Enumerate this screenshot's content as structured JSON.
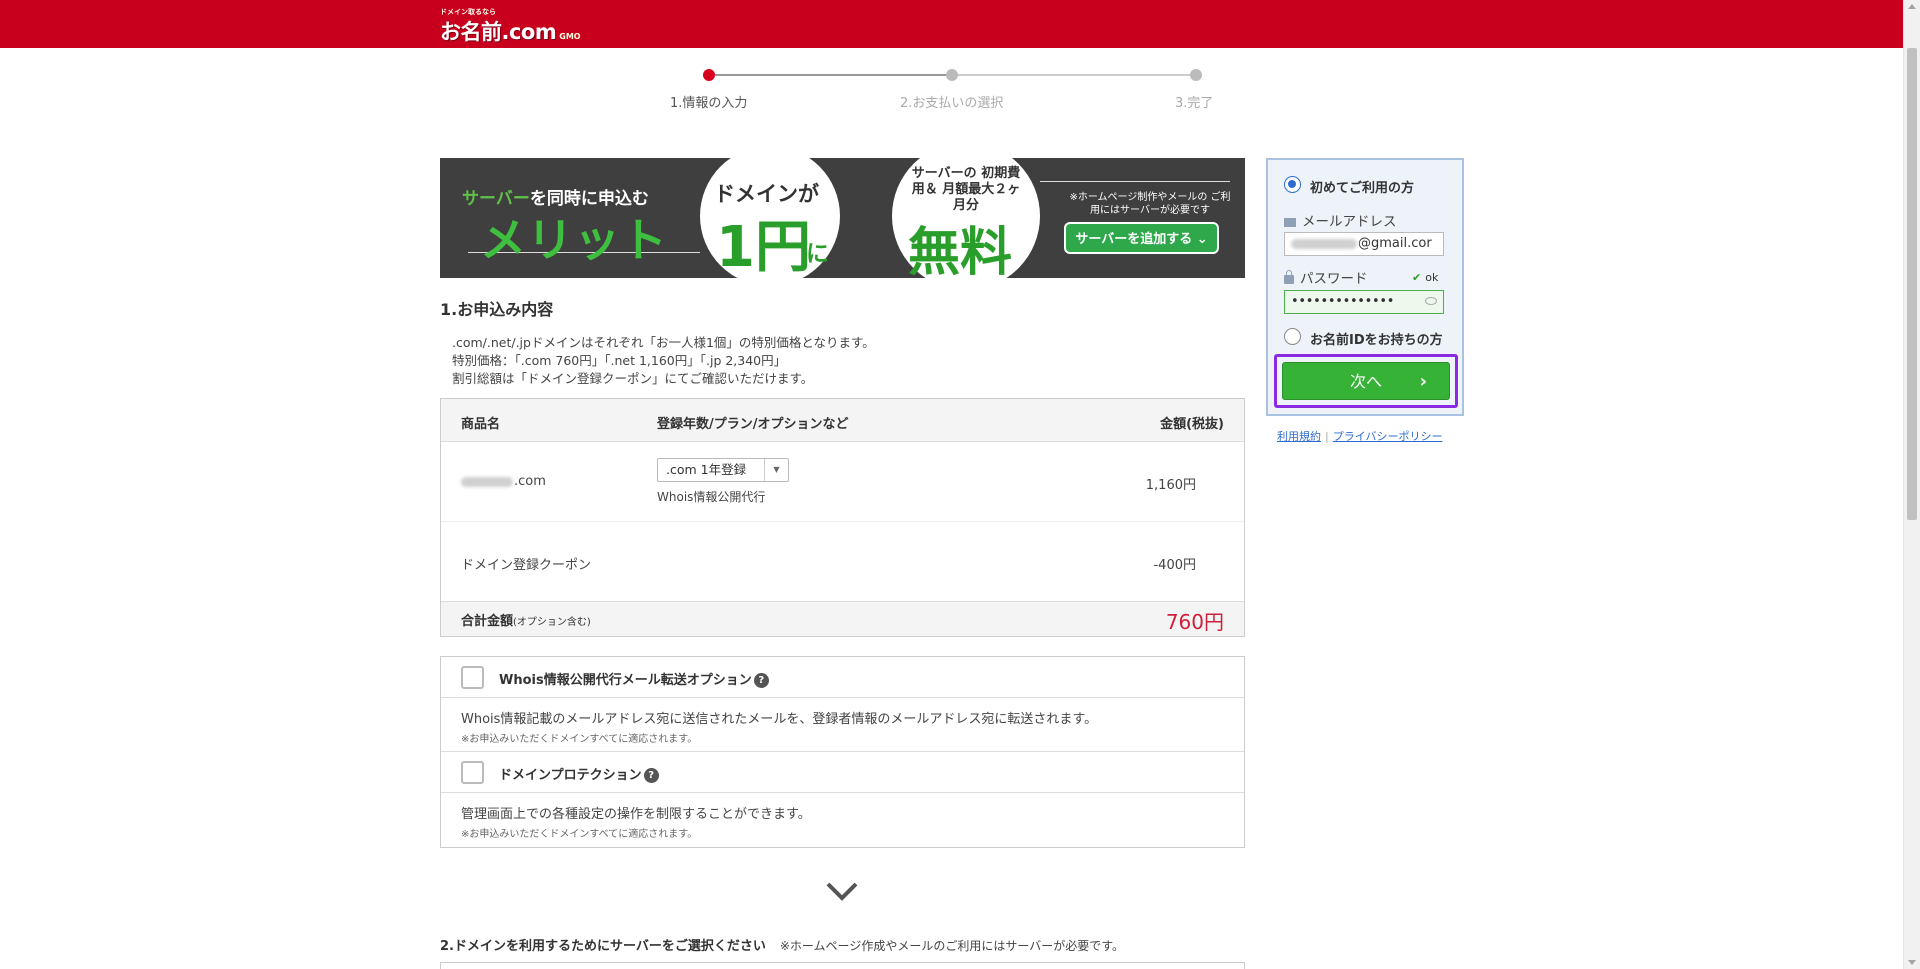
{
  "header": {
    "logo_small": "ドメイン取るなら",
    "logo_main": "お名前.com",
    "logo_sub": "GMO"
  },
  "steps": [
    {
      "label": "1.情報の入力",
      "active": true
    },
    {
      "label": "2.お支払いの選択",
      "active": false
    },
    {
      "label": "3.完了",
      "active": false
    }
  ],
  "banner": {
    "left_line1_green": "サーバー",
    "left_line1_rest": "を同時に申込む",
    "left_line2": "メリット",
    "circle1_line1": "ドメインが",
    "circle1_big": "1円",
    "circle1_suffix": "に",
    "circle2_text": "サーバーの 初期費用＆ 月額最大２ヶ月分",
    "circle2_big": "無料",
    "note": "※ホームページ制作やメールの ご利用にはサーバーが必要です",
    "button": "サーバーを追加する ⌄"
  },
  "section1": {
    "title": "1.お申込み内容",
    "desc_line1": ".com/.net/.jpドメインはそれぞれ「お一人様1個」の特別価格となります。",
    "desc_line2": "特別価格：「.com 760円」「.net 1,160円」「.jp 2,340円」",
    "desc_line3": "割引総額は「ドメイン登録クーポン」にてご確認いただけます。"
  },
  "table": {
    "headers": [
      "商品名",
      "登録年数/プラン/オプションなど",
      "金額(税抜)"
    ],
    "rows": [
      {
        "name": ".com",
        "plan": ".com 1年登録",
        "sub": "Whois情報公開代行",
        "price": "1,160円"
      },
      {
        "name": "ドメイン登録クーポン",
        "plan": "",
        "sub": "",
        "price": "-400円"
      }
    ],
    "total_label": "合計金額",
    "total_note": "(オプション含む)",
    "total_price": "760円"
  },
  "options": [
    {
      "label": "Whois情報公開代行メール転送オプション",
      "desc": "Whois情報記載のメールアドレス宛に送信されたメールを、登録者情報のメールアドレス宛に転送されます。",
      "note": "※お申込みいただくドメインすべてに適応されます。"
    },
    {
      "label": "ドメインプロテクション",
      "desc": "管理画面上での各種設定の操作を制限することができます。",
      "note": "※お申込みいただくドメインすべてに適応されます。"
    }
  ],
  "section2": {
    "title": "2.ドメインを利用するためにサーバーをご選択ください",
    "note": "※ホームページ作成やメールのご利用にはサーバーが必要です。"
  },
  "login": {
    "first_time_label": "初めてご利用の方",
    "email_label": "メールアドレス",
    "email_value_visible": "@gmail.cor",
    "password_label": "パスワード",
    "password_status": "ok",
    "password_value": "••••••••••••••",
    "has_id_label": "お名前IDをお持ちの方",
    "next_button": "次へ",
    "next_arrow": "›"
  },
  "links": {
    "terms": "利用規約",
    "separator": "|",
    "privacy": "プライバシーポリシー"
  },
  "colors": {
    "brand_red": "#c8001e",
    "accent_green": "#36b336",
    "price_red": "#d0203b",
    "link_blue": "#2e6bd1",
    "highlight_purple": "#8a2be2"
  }
}
